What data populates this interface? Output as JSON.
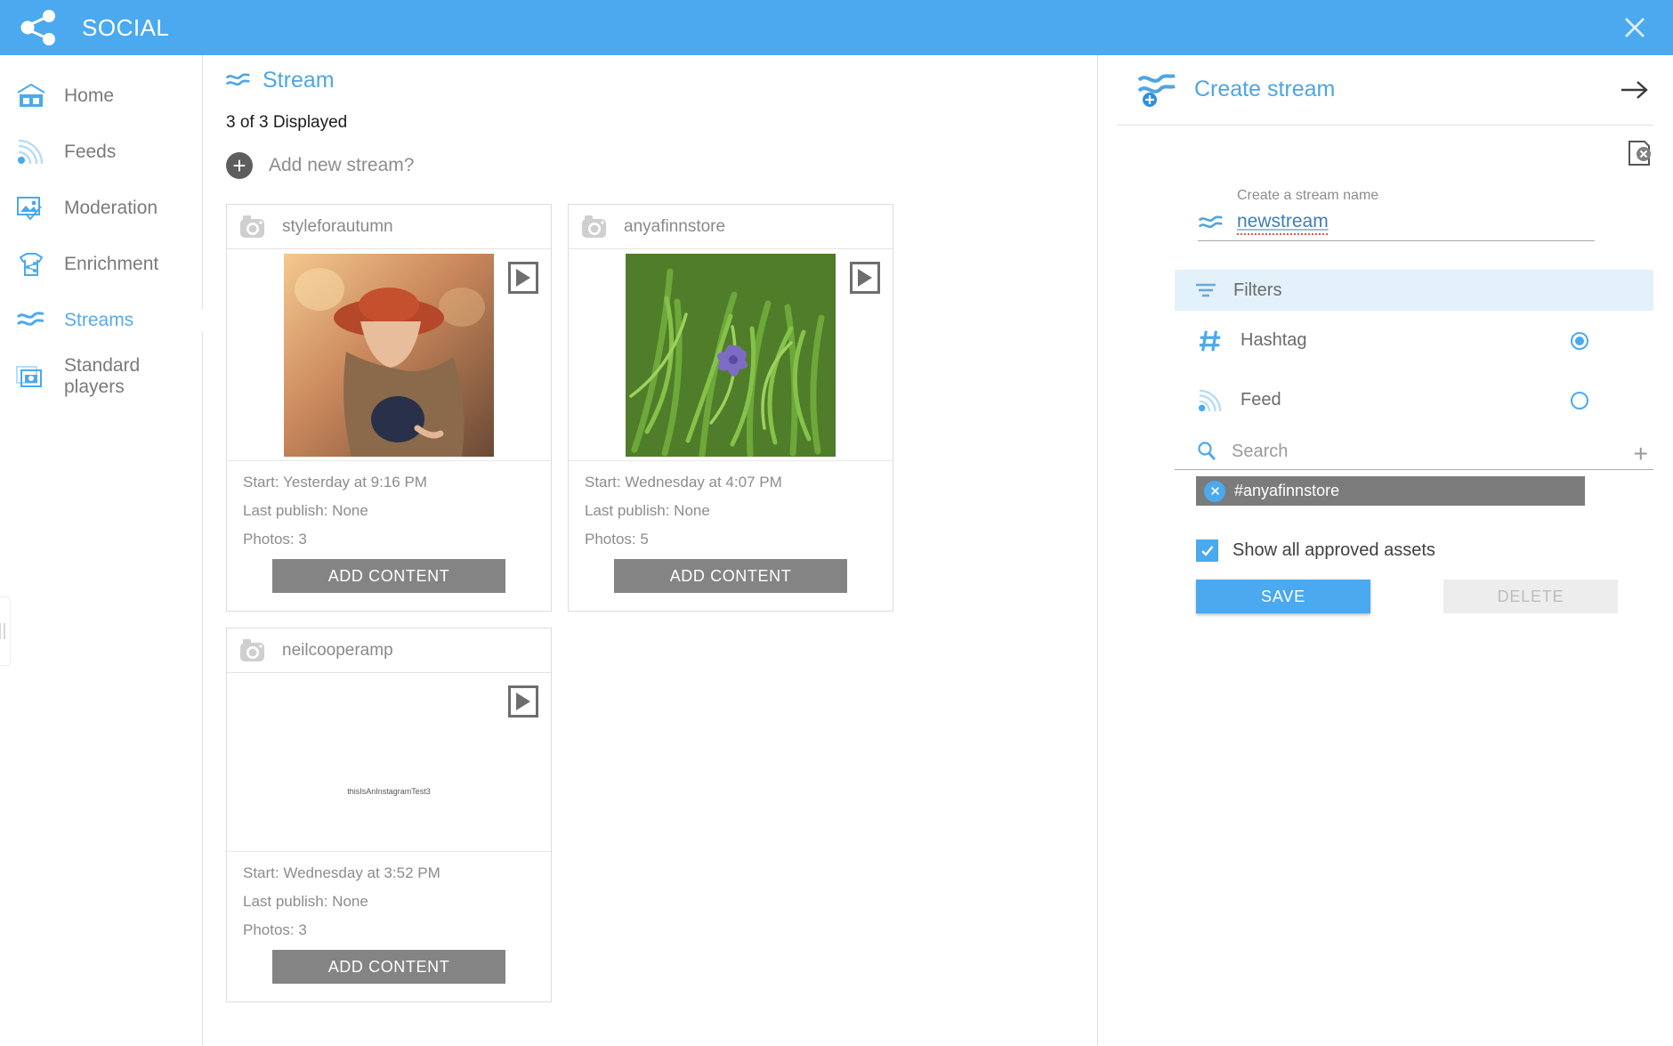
{
  "app": {
    "title": "SOCIAL",
    "accent": "#4aa9ef",
    "share_icon": "share-icon",
    "close_icon": "close-icon"
  },
  "sidebar": {
    "items": [
      {
        "label": "Home",
        "icon": "home-icon",
        "active": false
      },
      {
        "label": "Feeds",
        "icon": "rss-feed-icon",
        "active": false
      },
      {
        "label": "Moderation",
        "icon": "image-check-icon",
        "active": false
      },
      {
        "label": "Enrichment",
        "icon": "tshirt-share-icon",
        "active": false
      },
      {
        "label": "Streams",
        "icon": "waves-icon",
        "active": true
      },
      {
        "label": "Standard players",
        "icon": "players-icon",
        "active": false
      }
    ]
  },
  "main": {
    "heading": "Stream",
    "heading_icon": "waves-icon",
    "displayed_count": "3 of 3 Displayed",
    "add_new_label": "Add new stream?",
    "add_content_label": "ADD CONTENT",
    "cards": [
      {
        "name": "styleforautumn",
        "start": "Start: Yesterday at 9:16 PM",
        "last_publish": "Last publish: None",
        "photos": "Photos: 3",
        "thumb": "woman-autumn-hat-photo"
      },
      {
        "name": "anyafinnstore",
        "start": "Start: Wednesday at 4:07 PM",
        "last_publish": "Last publish: None",
        "photos": "Photos: 5",
        "thumb": "green-foliage-flower-photo"
      },
      {
        "name": "neilcooperamp",
        "start": "Start: Wednesday at 3:52 PM",
        "last_publish": "Last publish: None",
        "photos": "Photos: 3",
        "thumb": "text-placeholder",
        "placeholder_text": "thisIsAnInstagramTest3"
      }
    ]
  },
  "right_panel": {
    "heading": "Create stream",
    "heading_icon": "waves-plus-icon",
    "forward_icon": "arrow-right-icon",
    "clear_icon": "clear-page-icon",
    "stream_name": {
      "label": "Create a stream name",
      "value": "newstream",
      "icon": "waves-icon"
    },
    "filters": {
      "label": "Filters",
      "icon": "filter-icon",
      "options": [
        {
          "label": "Hashtag",
          "icon": "hashtag-icon",
          "selected": true
        },
        {
          "label": "Feed",
          "icon": "rss-feed-icon",
          "selected": false
        }
      ]
    },
    "search": {
      "placeholder": "Search",
      "icon": "search-icon",
      "add_icon": "plus-icon"
    },
    "tags": [
      {
        "label": "#anyafinnstore",
        "remove_icon": "close-circle-icon"
      }
    ],
    "checkbox": {
      "label": "Show all approved assets",
      "checked": true
    },
    "save_label": "SAVE",
    "delete_label": "DELETE"
  }
}
